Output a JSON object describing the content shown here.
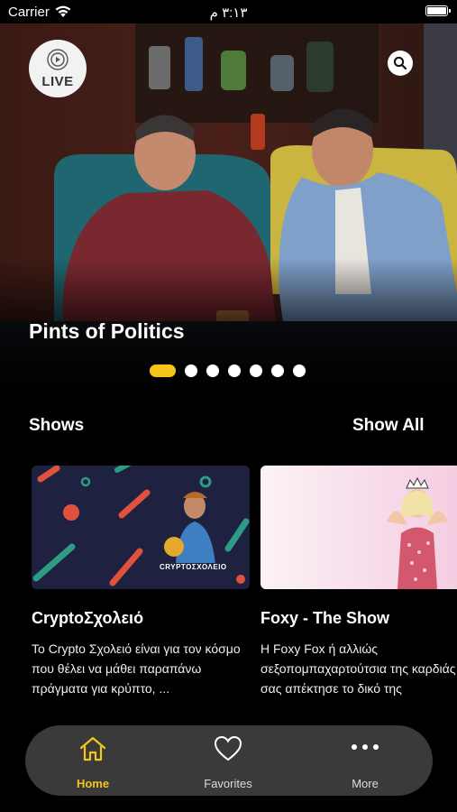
{
  "status_bar": {
    "carrier": "Carrier",
    "time": "٣:١٣ م"
  },
  "hero": {
    "live_label": "LIVE",
    "title": "Pints of Politics",
    "page_count": 7,
    "active_page": 1
  },
  "shows": {
    "title": "Shows",
    "show_all": "Show All",
    "items": [
      {
        "title": "CryptoΣχολειό",
        "description": "Το Crypto Σχολειό είναι για τον κόσμο που θέλει να μάθει παραπάνω πράγματα για κρύπτο, ...",
        "thumb_caption": "CRYPTOΣΧΟΛΕΙΟ"
      },
      {
        "title": "Foxy - The Show",
        "description": "Η Foxy Fox ή αλλιώς σεξοπομπαχαρτούτσια της καρδιάς σας απέκτησε το δικό της"
      }
    ]
  },
  "tab_bar": {
    "tabs": [
      {
        "label": "Home",
        "icon": "home-icon",
        "active": true
      },
      {
        "label": "Favorites",
        "icon": "heart-icon",
        "active": false
      },
      {
        "label": "More",
        "icon": "more-icon",
        "active": false
      }
    ]
  },
  "colors": {
    "accent": "#f5c518",
    "background": "#000000",
    "tab_bar": "#3a3a3a"
  }
}
